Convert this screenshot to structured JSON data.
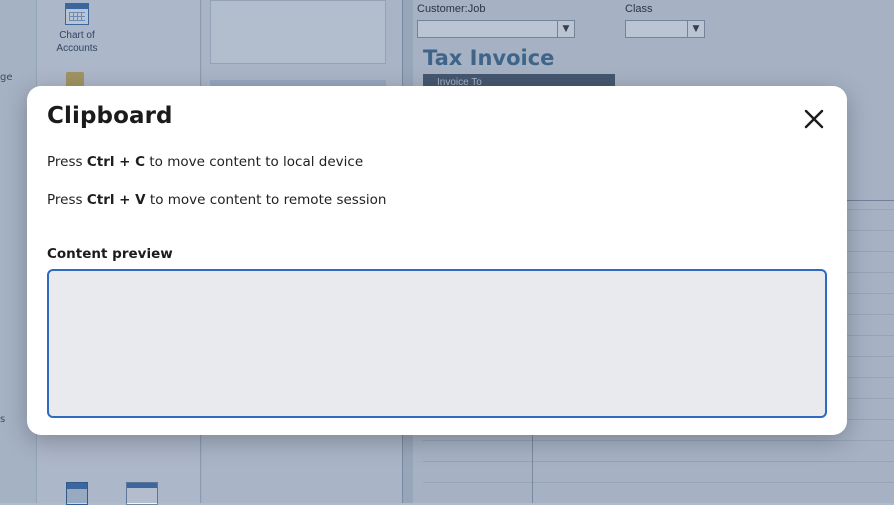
{
  "background_app": {
    "left_pane": {
      "tile_chart_of_accounts_line1": "Chart of",
      "tile_chart_of_accounts_line2": "Accounts",
      "cut_text_1": "ge",
      "cut_text_2": "s"
    },
    "form": {
      "customer_job_label": "Customer:Job",
      "class_label": "Class",
      "title": "Tax Invoice",
      "invoice_to_label": "Invoice To"
    }
  },
  "modal": {
    "title": "Clipboard",
    "close_icon": "close-icon",
    "instruction_copy": {
      "prefix": "Press ",
      "shortcut": "Ctrl + C",
      "suffix": " to move content to local device"
    },
    "instruction_paste": {
      "prefix": "Press ",
      "shortcut": "Ctrl + V",
      "suffix": " to move content to remote session"
    },
    "preview_label": "Content preview",
    "preview_value": ""
  },
  "colors": {
    "accent_border": "#2e6bc0",
    "preview_bg": "#e9eaed",
    "overlay": "rgba(60,85,125,0.35)"
  }
}
